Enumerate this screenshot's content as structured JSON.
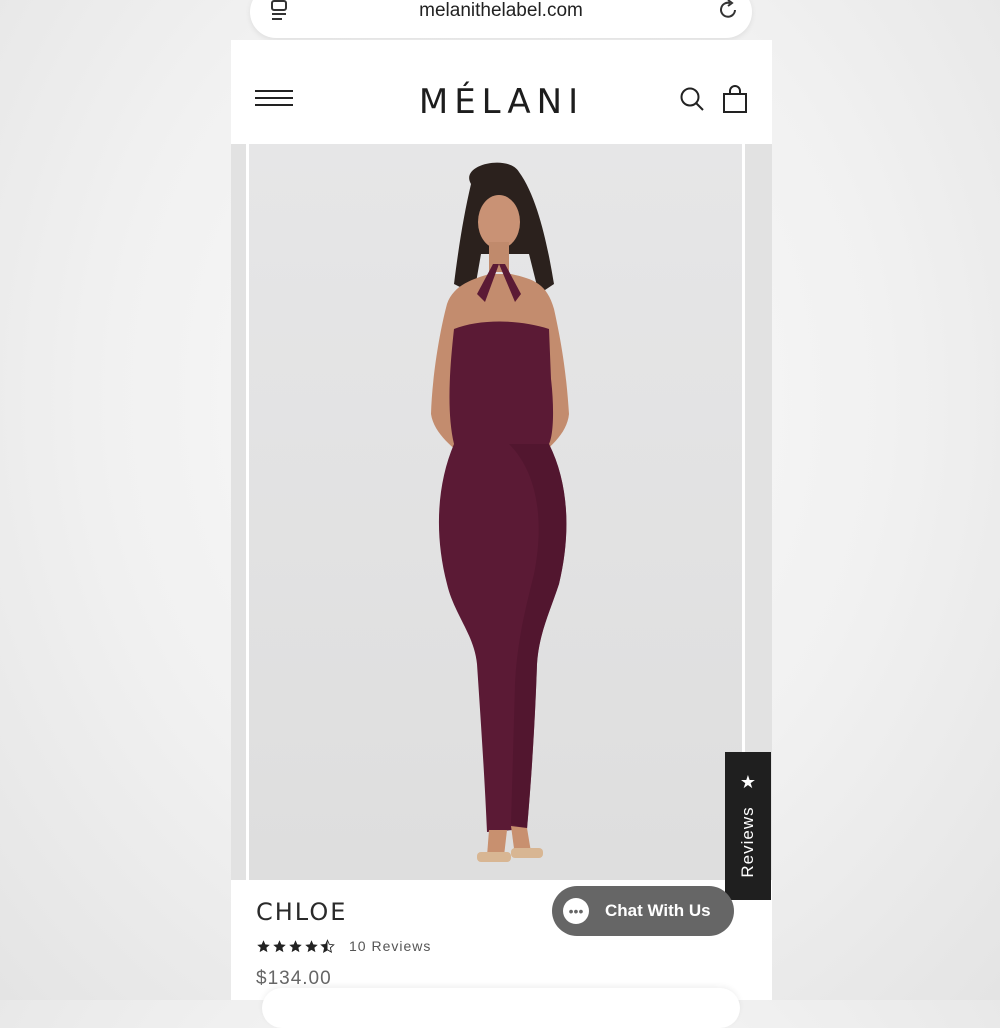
{
  "browser": {
    "url": "melanithelabel.com"
  },
  "header": {
    "logo": "MÉLANI"
  },
  "product": {
    "title": "CHLOE",
    "rating": 4.5,
    "reviews_text": "10 Reviews",
    "price": "$134.00",
    "dress_color": "#5b1a35"
  },
  "reviews_tab": {
    "label": "Reviews",
    "star": "★"
  },
  "chat": {
    "label": "Chat With Us",
    "icon": "chat-bubble-icon"
  },
  "colors": {
    "accent_dark": "#1f1f1f",
    "chat_bg": "#666666",
    "dress": "#5b1a35"
  }
}
